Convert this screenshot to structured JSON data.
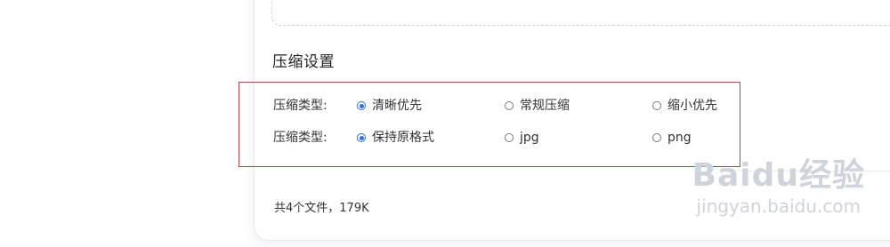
{
  "compression": {
    "section_title": "压缩设置",
    "rows": [
      {
        "label": "压缩类型:",
        "options": [
          {
            "label": "清晰优先",
            "selected": true
          },
          {
            "label": "常规压缩",
            "selected": false
          },
          {
            "label": "缩小优先",
            "selected": false
          }
        ]
      },
      {
        "label": "压缩类型:",
        "options": [
          {
            "label": "保持原格式",
            "selected": true
          },
          {
            "label": "jpg",
            "selected": false
          },
          {
            "label": "png",
            "selected": false
          }
        ]
      }
    ]
  },
  "footer": {
    "file_summary": "共4个文件，179K"
  },
  "watermark": {
    "logo_text": "Baidu经验",
    "site": "jingyan.baidu.com"
  },
  "colors": {
    "accent": "#2f6fd8",
    "highlight_border": "#a84a48"
  }
}
